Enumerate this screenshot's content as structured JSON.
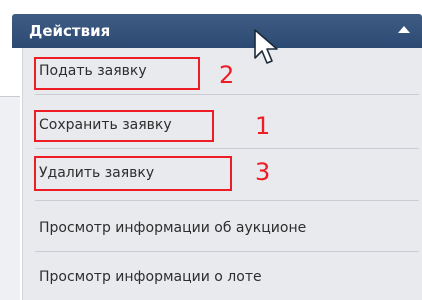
{
  "header": {
    "title": "Действия",
    "icon": "chevron-up-icon"
  },
  "menu": {
    "items": [
      {
        "label": "Подать заявку",
        "annotation": "2"
      },
      {
        "label": "Сохранить заявку",
        "annotation": "1"
      },
      {
        "label": "Удалить заявку",
        "annotation": "3"
      },
      {
        "label": "Просмотр информации об аукционе"
      },
      {
        "label": "Просмотр информации о лоте"
      }
    ]
  },
  "colors": {
    "header": "#2f4d76",
    "menu_background": "#e8eaee",
    "highlight": "#ee1c25",
    "text": "#2e2e2e"
  }
}
